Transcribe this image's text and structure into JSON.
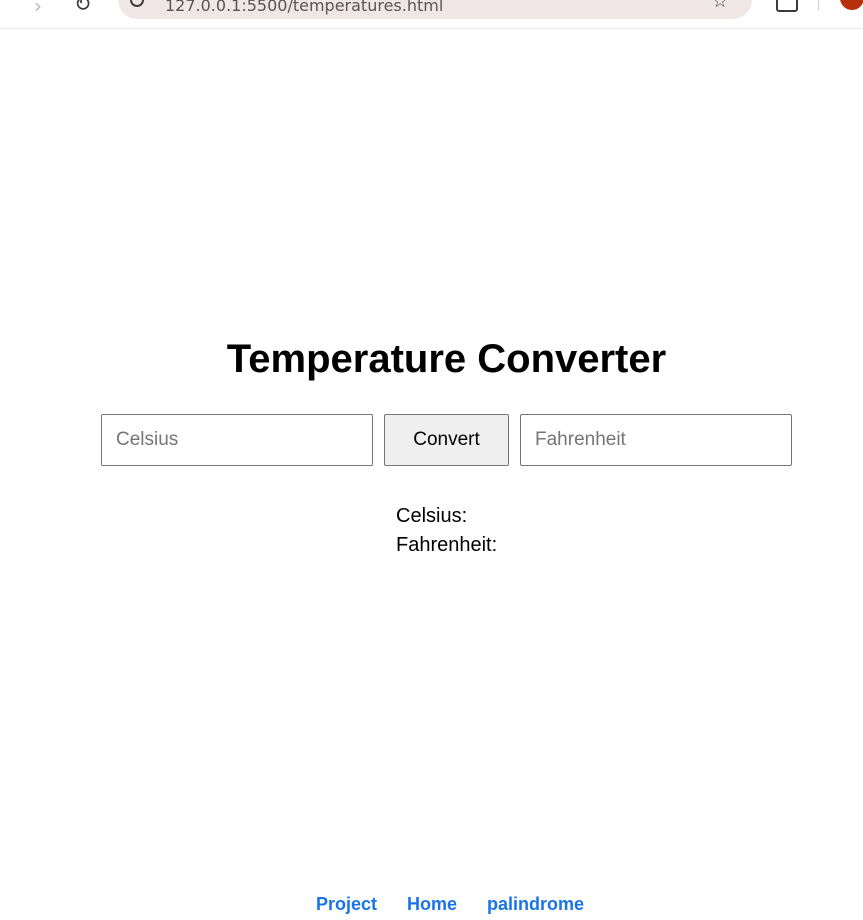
{
  "browser": {
    "url": "127.0.0.1:5500/temperatures.html"
  },
  "page": {
    "title": "Temperature Converter"
  },
  "converter": {
    "celsius_placeholder": "Celsius",
    "celsius_value": "",
    "convert_label": "Convert",
    "fahrenheit_placeholder": "Fahrenheit",
    "fahrenheit_value": ""
  },
  "results": {
    "celsius_label": "Celsius:",
    "fahrenheit_label": "Fahrenheit:"
  },
  "footer": {
    "links": [
      "Project",
      "Home",
      "palindrome"
    ]
  },
  "colors": {
    "link": "#1a73e8",
    "button_bg": "#efefef",
    "address_bar_bg": "#f1e6e6",
    "avatar_bg": "#b5300b"
  }
}
